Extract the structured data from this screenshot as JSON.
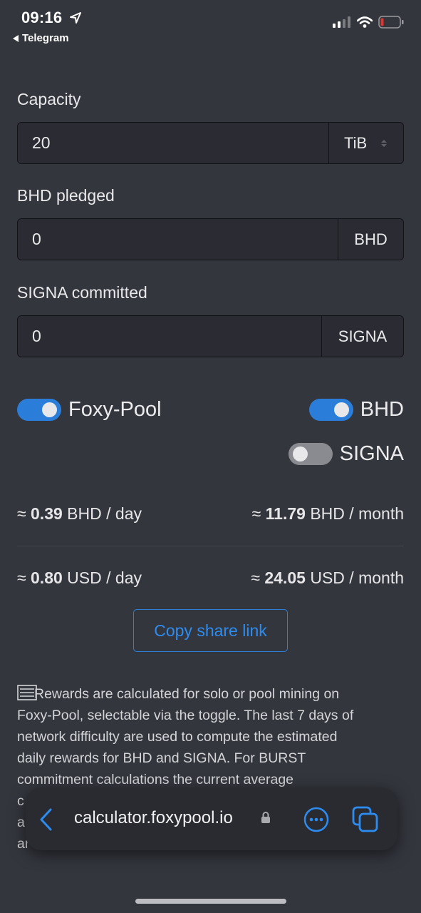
{
  "status_bar": {
    "time": "09:16",
    "back_app": "Telegram"
  },
  "form": {
    "capacity": {
      "label": "Capacity",
      "value": "20",
      "unit": "TiB"
    },
    "bhd_pledged": {
      "label": "BHD pledged",
      "value": "0",
      "unit": "BHD"
    },
    "signa_committed": {
      "label": "SIGNA committed",
      "value": "0",
      "unit": "SIGNA"
    }
  },
  "toggles": {
    "foxy_pool": {
      "label": "Foxy-Pool",
      "on": true
    },
    "bhd": {
      "label": "BHD",
      "on": true
    },
    "signa": {
      "label": "SIGNA",
      "on": false
    }
  },
  "rewards": {
    "approx": "≈",
    "bhd_day": {
      "value": "0.39",
      "unit": "BHD / day"
    },
    "bhd_month": {
      "value": "11.79",
      "unit": "BHD / month"
    },
    "usd_day": {
      "value": "0.80",
      "unit": "USD / day"
    },
    "usd_month": {
      "value": "24.05",
      "unit": "USD / month"
    }
  },
  "copy_button": "Copy share link",
  "info": {
    "line1": "Rewards are calculated for solo or pool mining on",
    "line2": "Foxy-Pool, selectable via the toggle. The last 7 days of",
    "line3": "network difficulty are used to compute the estimated",
    "line4": "daily rewards for BHD and SIGNA. For BURST",
    "line5": "commitment calculations the current average",
    "line6": "c",
    "line7": "a",
    "line8": "ar"
  },
  "url_bar": {
    "url": "calculator.foxypool.io"
  },
  "colors": {
    "background": "#34363e",
    "accent": "#2a7ed9",
    "link": "#2d8cf0"
  },
  "icons": [
    "location-arrow-icon",
    "signal-icon",
    "wifi-icon",
    "battery-icon",
    "chevron-left-icon",
    "lock-icon",
    "more-icon",
    "tabs-icon"
  ]
}
